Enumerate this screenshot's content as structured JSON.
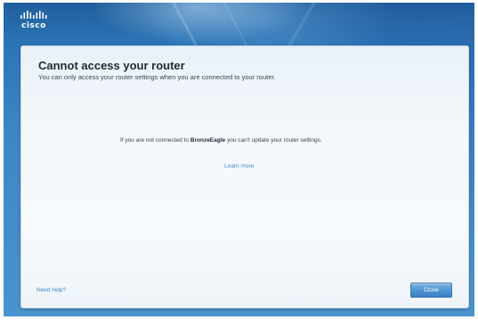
{
  "brand": {
    "logo_text": "cisco"
  },
  "dialog": {
    "title": "Cannot access your router",
    "subtitle": "You can only access your router settings when you are connected to your router.",
    "message_before": "If you are not connected to ",
    "network_name": "BronzeEagle",
    "message_after": " you can't update your router settings.",
    "learn_more_label": "Learn more",
    "help_label": "Need help?",
    "close_label": "Close"
  },
  "colors": {
    "background_blue": "#2b73b5",
    "link_blue": "#3d8ecf",
    "button_blue": "#4d93d1"
  },
  "icons": {
    "logo": "cisco-logo-icon"
  }
}
